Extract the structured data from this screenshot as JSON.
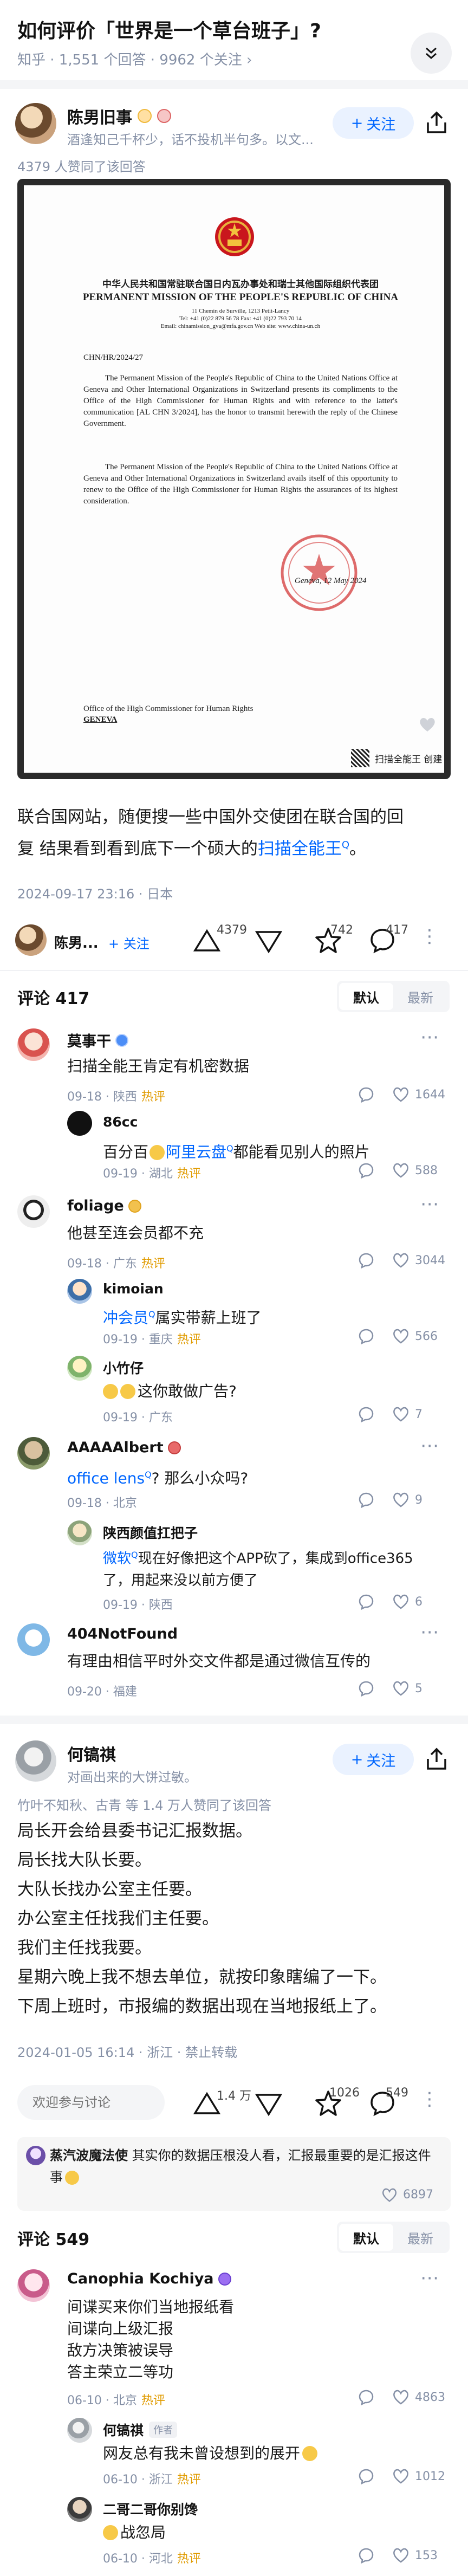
{
  "question": {
    "title": "如何评价「世界是一个草台班子」?",
    "meta": "知乎 · 1,551 个回答 · 9962 个关注 ›"
  },
  "answer1": {
    "author": "陈男旧事",
    "bio": "酒逢知己千杯少，话不投机半句多。以文...",
    "follow_label": "关注",
    "upvote_note": "4379 人赞同了该回答",
    "document": {
      "header_cn": "中华人民共和国常驻联合国日内瓦办事处和瑞士其他国际组织代表团",
      "header_en": "PERMANENT MISSION OF THE PEOPLE'S REPUBLIC OF CHINA",
      "address": "11 Chemin de Surville, 1213 Petit-Lancy",
      "phone": "Tel: +41 (0)22 879 56 78    Fax: +41 (0)22 793 70 14",
      "email": "Email: chinamission_gva@mfa.gov.cn    Web site: www.china-un.ch",
      "ref": "CHN/HR/2024/27",
      "para1": "The Permanent Mission of the People's Republic of China to the United Nations Office at Geneva and Other International Organizations in Switzerland presents its compliments to the Office of the High Commissioner for Human Rights and with reference to the latter's communication [AL CHN 3/2024], has the honor to transmit herewith the reply of the Chinese Government.",
      "para2": "The Permanent Mission of the People's Republic of China to the United Nations Office at Geneva and Other International Organizations in Switzerland avails itself of this opportunity to renew to the Office of the High Commissioner for Human Rights the assurances of its highest consideration.",
      "date": "Geneva, 12 May 2024",
      "to1": "Office of the High Commissioner for Human Rights",
      "to2": "GENEVA",
      "watermark": "扫描全能王 创建"
    },
    "text_line1": "联合国网站，随便搜一些中国外交使团在联合国的回",
    "text_line2_a": "复 结果看到看到底下一个硕大的",
    "text_link": "扫描全能王",
    "text_line2_end": "。",
    "time": "2024-09-17 23:16 · 日本",
    "bar_author": "陈男...",
    "bar_follow": "关注",
    "upvotes": "4379",
    "stars": "742",
    "comments": "417"
  },
  "comments1": {
    "title": "评论 417",
    "tab_default": "默认",
    "tab_latest": "最新",
    "items": [
      {
        "name": "莫事干",
        "text": "扫描全能王肯定有机密数据",
        "date": "09-18 · 陕西",
        "tag": "热评",
        "likes": "1644"
      },
      {
        "name": "86cc",
        "text_a": "百分百",
        "text_link": "阿里云盘",
        "text_b": "都能看见别人的照片",
        "date": "09-19 · 湖北",
        "tag": "热评",
        "likes": "588"
      },
      {
        "name": "foliage",
        "text": "他甚至连会员都不充",
        "date": "09-18 · 广东",
        "tag": "热评",
        "likes": "3044"
      },
      {
        "name": "kimoian",
        "text_link": "冲会员",
        "text_b": "属实带薪上班了",
        "date": "09-19 · 重庆",
        "tag": "热评",
        "likes": "566"
      },
      {
        "name": "小竹仔",
        "text": "这你敢做广告?",
        "date": "09-19 · 广东",
        "likes": "7"
      },
      {
        "name": "AAAAAlbert",
        "text_link": "office lens",
        "text_b": "? 那么小众吗?",
        "date": "09-18 · 北京",
        "likes": "9"
      },
      {
        "name": "陕西颜值扛把子",
        "text_link": "微软",
        "text_b": "现在好像把这个APP砍了，集成到office365了，用起来没以前方便了",
        "date": "09-19 · 陕西",
        "likes": "6"
      },
      {
        "name": "404NotFound",
        "text": "有理由相信平时外交文件都是通过微信互传的",
        "date": "09-20 · 福建",
        "likes": "5"
      }
    ]
  },
  "answer2": {
    "author": "何镐祺",
    "bio": "对画出来的大饼过敏。",
    "follow_label": "关注",
    "upvote_note": "竹叶不知秋、古青 等 1.4 万人赞同了该回答",
    "lines": [
      "局长开会给县委书记汇报数据。",
      "局长找大队长要。",
      "大队长找办公室主任要。",
      "办公室主任找我们主任要。",
      "我们主任找我要。",
      "星期六晚上我不想去单位，就按印象瞎编了一下。",
      "下周上班时，市报编的数据出现在当地报纸上了。"
    ],
    "time": "2024-01-05 16:14 · 浙江 · 禁止转载",
    "input_placeholder": "欢迎参与讨论",
    "upvotes": "1.4 万",
    "stars": "1026",
    "comments": "549",
    "pinned_name": "蒸汽波魔法使",
    "pinned_text": "其实你的数据压根没人看，汇报最重要的是汇报这件事",
    "pinned_likes": "6897"
  },
  "comments2": {
    "title": "评论 549",
    "tab_default": "默认",
    "tab_latest": "最新",
    "items": [
      {
        "name": "Canophia Kochiya",
        "lines": [
          "间谍买来你们当地报纸看",
          "间谍向上级汇报",
          "敌方决策被误导",
          "答主荣立二等功"
        ],
        "date": "06-10 · 北京",
        "tag": "热评",
        "likes": "4863"
      },
      {
        "name": "何镐祺",
        "badge": "作者",
        "text": "网友总有我未曾设想到的展开",
        "date": "06-10 · 浙江",
        "tag": "热评",
        "likes": "1012"
      },
      {
        "name": "二哥二哥你别馋",
        "text": "战忽局",
        "date": "06-10 · 河北",
        "tag": "热评",
        "likes": "153"
      }
    ]
  }
}
